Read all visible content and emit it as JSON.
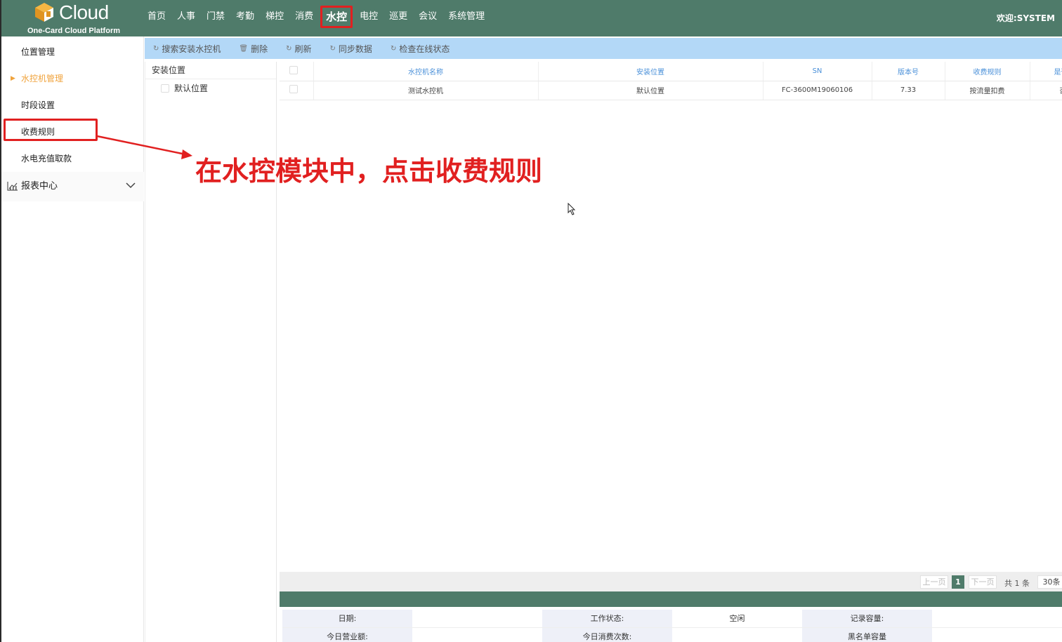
{
  "header": {
    "brand": "Cloud",
    "tagline": "One-Card Cloud Platform",
    "nav": [
      "首页",
      "人事",
      "门禁",
      "考勤",
      "梯控",
      "消费",
      "水控",
      "电控",
      "巡更",
      "会议",
      "系统管理"
    ],
    "active_nav": "水控",
    "welcome": "欢迎:SYSTEM"
  },
  "sidebar": {
    "items": [
      "位置管理",
      "水控机管理",
      "时段设置",
      "收费规则",
      "水电充值取款"
    ],
    "current": "水控机管理",
    "highlighted": "收费规则",
    "group": "报表中心"
  },
  "toolbar": {
    "search": "搜索安装水控机",
    "delete": "删除",
    "refresh": "刷新",
    "sync": "同步数据",
    "check_online": "检查在线状态"
  },
  "tree": {
    "header": "安装位置",
    "nodes": [
      "默认位置"
    ]
  },
  "grid": {
    "columns": [
      "水控机名称",
      "安装位置",
      "SN",
      "版本号",
      "收费规则",
      "是否"
    ],
    "rows": [
      [
        "测试水控机",
        "默认位置",
        "FC-3600M19060106",
        "7.33",
        "按流量扣费",
        "否"
      ]
    ]
  },
  "pager": {
    "prev": "上一页",
    "page": "1",
    "next": "下一页",
    "total": "共 1 条",
    "page_size": "30条"
  },
  "detail": {
    "row1": [
      "日期:",
      "",
      "工作状态:",
      "空闲",
      "记录容量:",
      ""
    ],
    "row2": [
      "今日营业额:",
      "",
      "今日消费次数:",
      "",
      "黑名单容量",
      ""
    ]
  },
  "annotation": "在水控模块中，点击收费规则",
  "colors": {
    "header_bg": "#4f7b6a",
    "toolbar_bg": "#b3d8f7",
    "highlight": "#e12020",
    "active_side": "#f0a33c"
  }
}
